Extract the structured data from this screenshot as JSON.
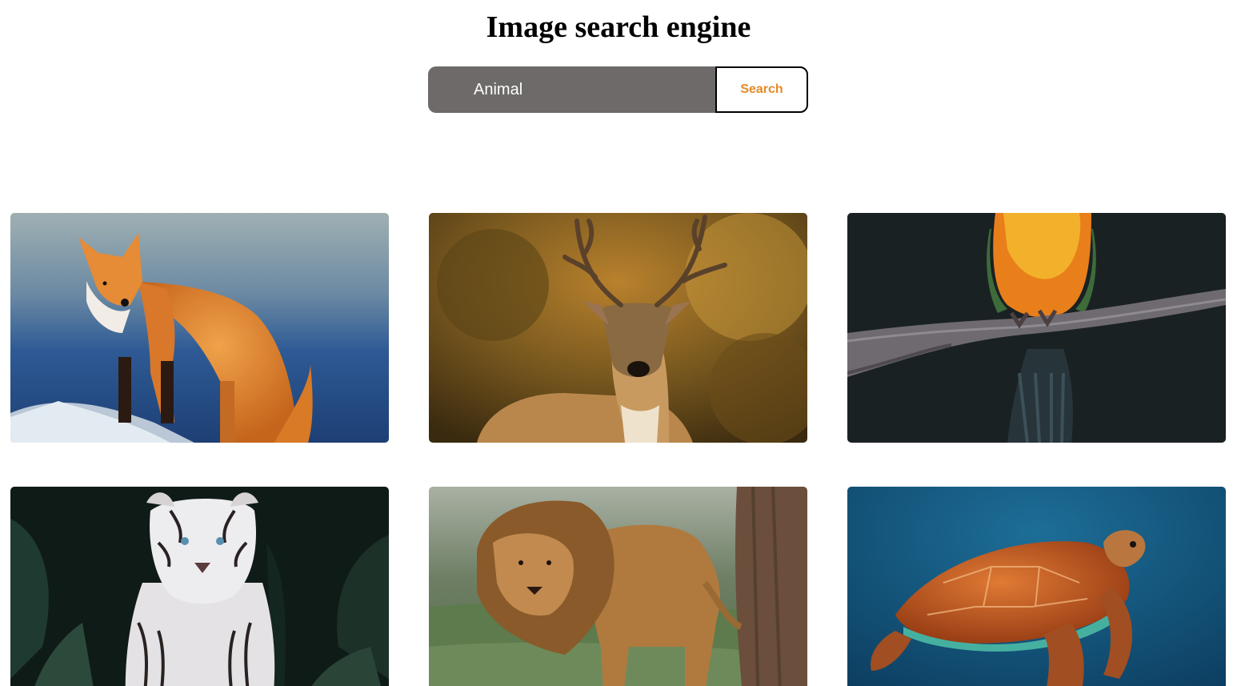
{
  "header": {
    "title": "Image search engine"
  },
  "search": {
    "value": "Animal",
    "button_label": "Search"
  },
  "colors": {
    "input_bg": "#6d6a69",
    "button_text": "#e48a2a"
  },
  "results": [
    {
      "subject": "fox"
    },
    {
      "subject": "deer"
    },
    {
      "subject": "parrot"
    },
    {
      "subject": "white tiger"
    },
    {
      "subject": "lion"
    },
    {
      "subject": "sea turtle"
    }
  ]
}
